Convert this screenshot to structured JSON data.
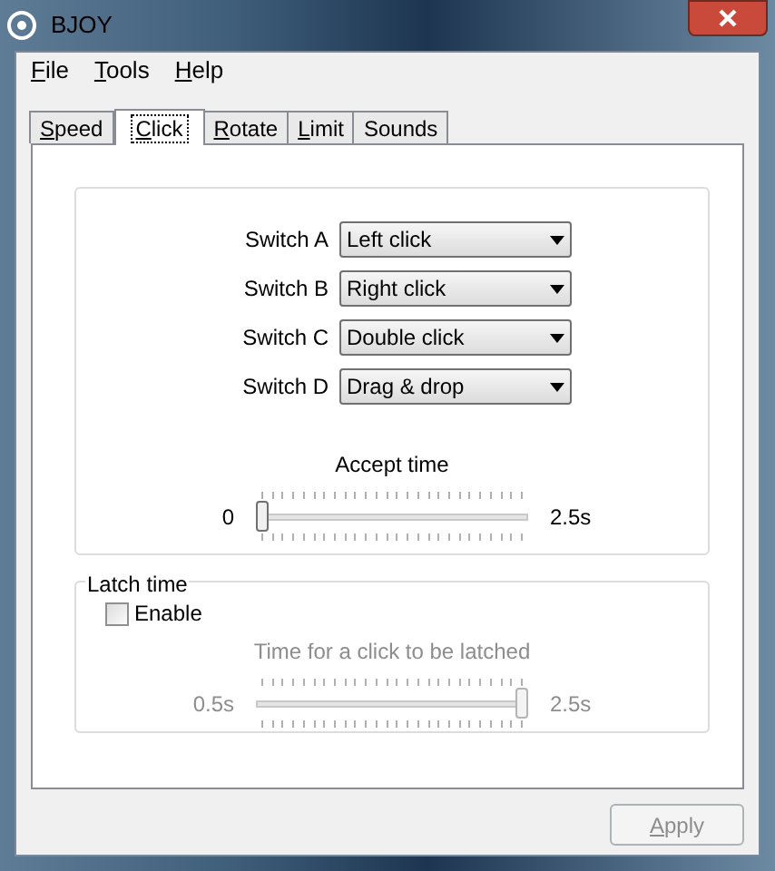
{
  "window": {
    "title": "BJOY"
  },
  "menu": [
    {
      "label": "File",
      "underline_first": true
    },
    {
      "label": "Tools",
      "underline_first": true
    },
    {
      "label": "Help",
      "underline_first": true
    }
  ],
  "tabs": [
    {
      "label": "Speed",
      "selected": false,
      "underline_first": true
    },
    {
      "label": "Click",
      "selected": true,
      "underline_first": true
    },
    {
      "label": "Rotate",
      "selected": false,
      "underline_first": true
    },
    {
      "label": "Limit",
      "selected": false,
      "underline_first": true
    },
    {
      "label": "Sounds",
      "selected": false,
      "underline_first": false
    }
  ],
  "switches": [
    {
      "label": "Switch A",
      "value": "Left click"
    },
    {
      "label": "Switch B",
      "value": "Right click"
    },
    {
      "label": "Switch C",
      "value": "Double click"
    },
    {
      "label": "Switch D",
      "value": "Drag & drop"
    }
  ],
  "accept_time": {
    "title": "Accept time",
    "min_label": "0",
    "max_label": "2.5s",
    "level": 0,
    "disabled": false
  },
  "latch": {
    "group_title": "Latch time",
    "enable": {
      "label": "Enable",
      "checked": false
    },
    "title": "Time for a click to be latched",
    "min_label": "0.5s",
    "max_label": "2.5s",
    "level": 1,
    "disabled": true
  },
  "apply_button": {
    "label": "Apply",
    "underline_first": true,
    "disabled": true
  }
}
